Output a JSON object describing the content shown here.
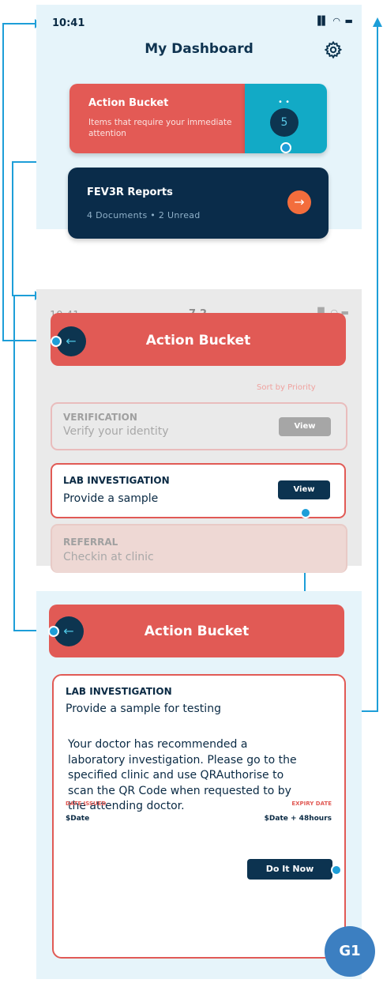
{
  "dashboard": {
    "time": "10:41",
    "status_icons": "▐▌ ◠ ▬",
    "title": "My Dashboard",
    "settings_icon": "gear-icon",
    "action_bucket": {
      "title": "Action Bucket",
      "subtitle": "Items that require your immediate attention",
      "count": "5",
      "dots": "• •"
    },
    "fev3r": {
      "title": "FEV3R Reports",
      "meta": "4 Documents  •  2 Unread",
      "arrow": "→"
    }
  },
  "action_list": {
    "time": "10:41",
    "step": "7.2",
    "status_icons": "▐▌ ◠ ▬",
    "back": "←",
    "header": "Action Bucket",
    "sort_label": "Sort by Priority",
    "items": [
      {
        "title": "VERIFICATION",
        "subtitle": "Verify your identity",
        "button": "View"
      },
      {
        "title": "LAB INVESTIGATION",
        "subtitle": "Provide a sample",
        "button": "View"
      },
      {
        "title": "REFERRAL",
        "subtitle": "Checkin at clinic"
      }
    ]
  },
  "detail": {
    "back": "←",
    "header": "Action Bucket",
    "title": "LAB INVESTIGATION",
    "subtitle": "Provide a sample for testing",
    "body": "Your doctor has recommended a laboratory investigation. Please go to the specified clinic and use QRAuthorise to scan the QR Code when requested to by the attending doctor.",
    "date_issued_label": "DATE ISSUED",
    "date_issued_value": "$Date",
    "expiry_label": "EXPIRY DATE",
    "expiry_value": "$Date + 48hours",
    "button": "Do It Now"
  },
  "badge": "G1",
  "colors": {
    "accent_red": "#e15a55",
    "navy": "#0c3350",
    "teal": "#12aac6",
    "orange": "#f36d3c",
    "connector": "#1d9ed8",
    "panel_bg": "#e6f4fa"
  }
}
